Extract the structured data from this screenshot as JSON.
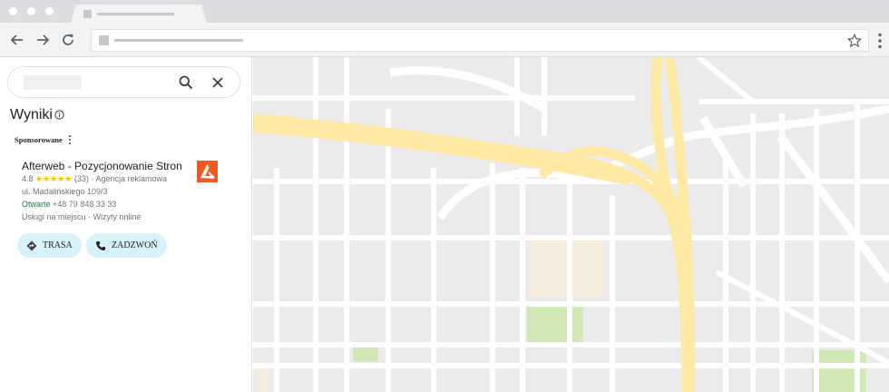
{
  "browser": {
    "icons": [
      "back-arrow-icon",
      "forward-arrow-icon",
      "reload-icon",
      "star-icon",
      "menu-dots-icon"
    ]
  },
  "results_panel": {
    "title": "Wyniki",
    "sponsored_label": "Sponsorowane",
    "listing": {
      "name": "Afterweb - Pozycjonowanie Stron",
      "rating": "4.8",
      "stars": "★★★★★",
      "review_count": "(33)",
      "category": "Agencja reklamowa",
      "address": "ul. Madalińskiego 109/3",
      "status": "Otwarte",
      "phone": "+48 79 848 33 33",
      "services": "Usługi na miejscu · Wizyty online"
    },
    "buttons": {
      "route": "TRASA",
      "call": "ZADZWOŃ"
    }
  },
  "colors": {
    "road_major": "#fde9a4",
    "map_bg": "#ebebeb",
    "park": "#cfe8b5",
    "building": "#f5eddc",
    "open_status": "#188038",
    "action_button": "#d8f2fb",
    "star": "#fbbc04",
    "logo": "#ef5a24"
  }
}
